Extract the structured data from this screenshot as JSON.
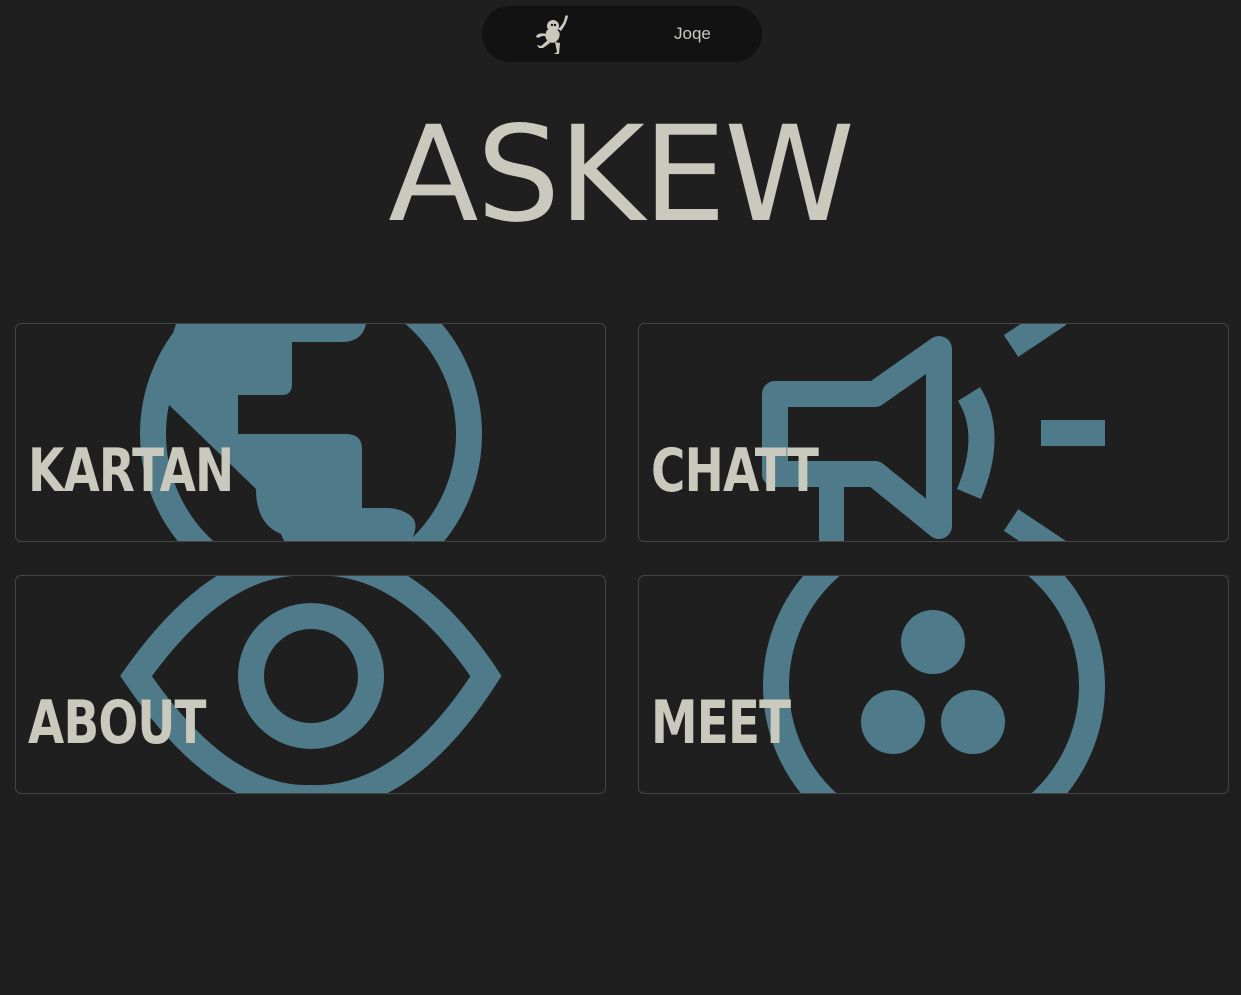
{
  "nav": {
    "logo_icon": "monkey-logo-icon",
    "user_name": "Joqe"
  },
  "title": "ASKEW",
  "colors": {
    "background": "#1f1f1f",
    "text": "#c9c9bd",
    "icon_accent": "#4e7a8a",
    "nav_bg": "#121212"
  },
  "cards": [
    {
      "label": "KARTAN",
      "icon": "globe-icon"
    },
    {
      "label": "CHATT",
      "icon": "megaphone-icon"
    },
    {
      "label": "ABOUT",
      "icon": "eye-icon"
    },
    {
      "label": "MEET",
      "icon": "group-circle-icon"
    }
  ]
}
